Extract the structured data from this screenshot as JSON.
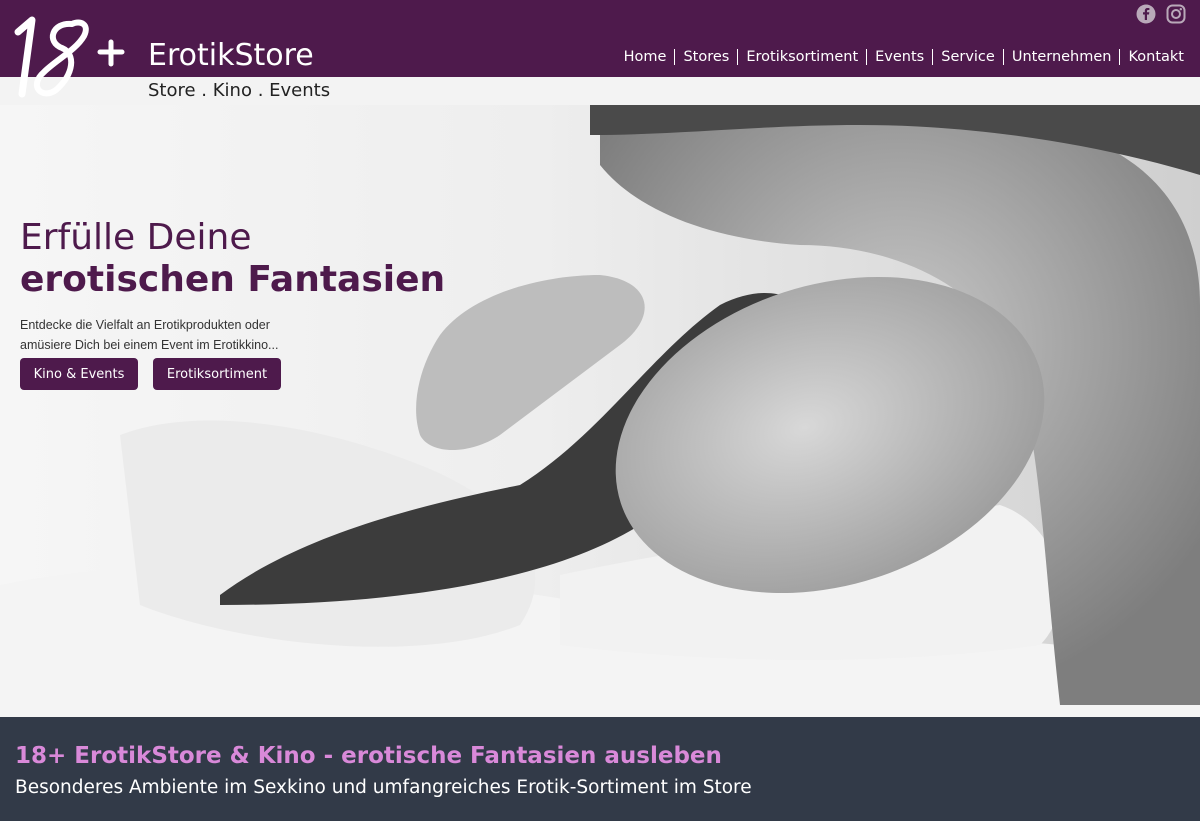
{
  "header": {
    "brand": "ErotikStore",
    "logo_text": "18+",
    "tagline": "Store . Kino . Events",
    "social_icons": [
      "facebook-icon",
      "instagram-icon"
    ],
    "nav": [
      "Home",
      "Stores",
      "Erotiksortiment",
      "Events",
      "Service",
      "Unternehmen",
      "Kontakt"
    ]
  },
  "hero": {
    "title_line1": "Erfülle Deine",
    "title_line2": "erotischen Fantasien",
    "text_line1": "Entdecke die Vielfalt an Erotikprodukten oder",
    "text_line2": "amüsiere Dich bei einem Event im Erotikkino...",
    "button_kino": "Kino & Events",
    "button_sortiment": "Erotiksortiment"
  },
  "band": {
    "title": "18+ ErotikStore & Kino - erotische Fantasien ausleben",
    "subtitle": "Besonderes Ambiente im Sexkino und umfangreiches Erotik-Sortiment im Store"
  },
  "colors": {
    "brand_purple": "#4e1a4c",
    "band_bg": "#323a48",
    "band_title": "#d989d9"
  }
}
